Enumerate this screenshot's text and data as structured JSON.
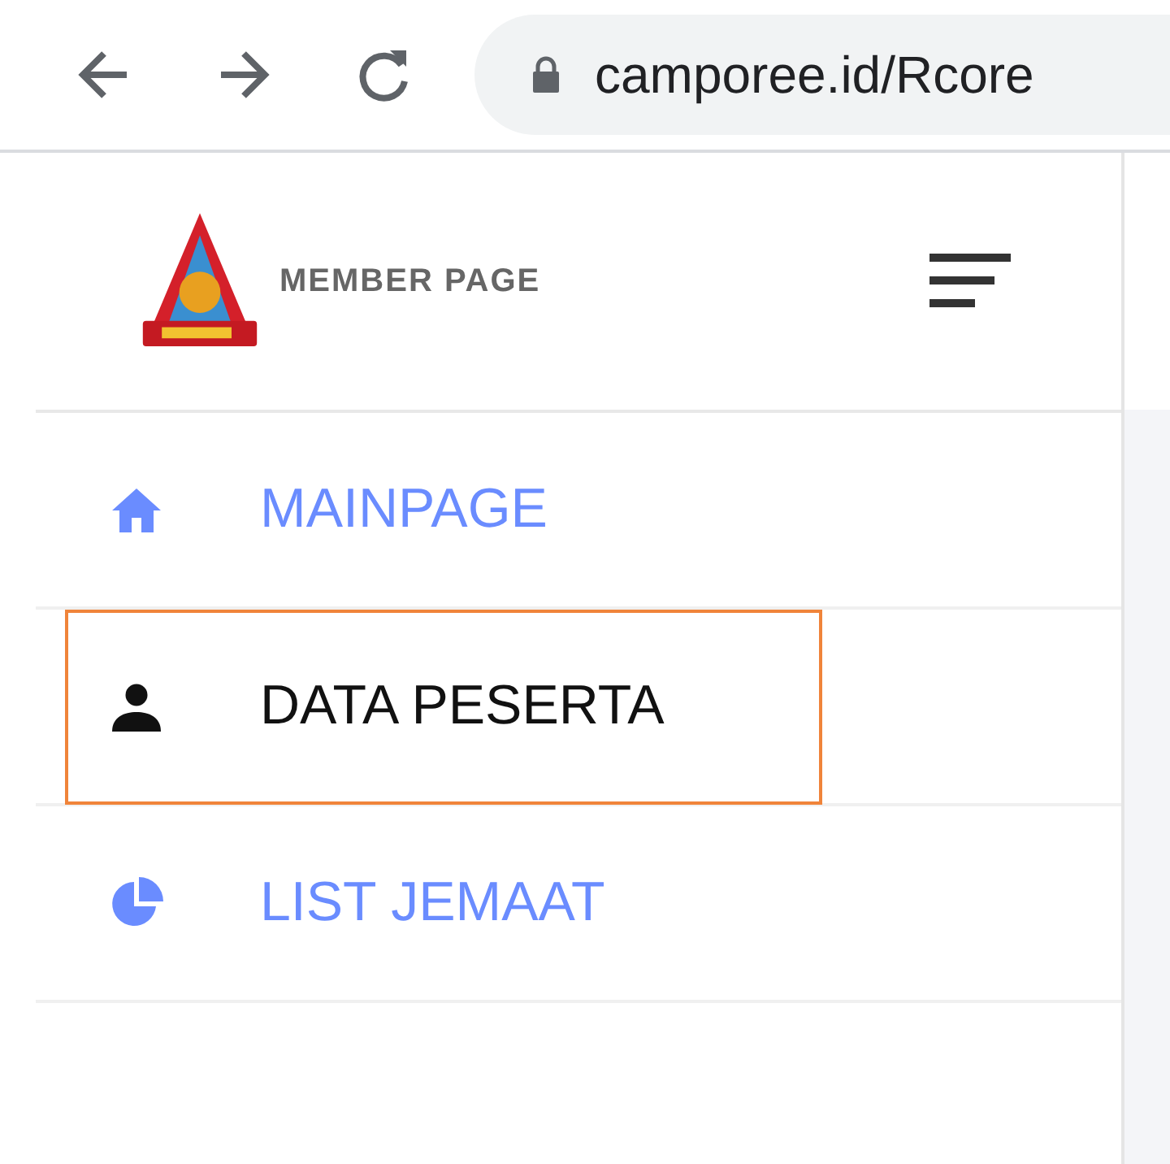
{
  "browser": {
    "url": "camporee.id/Rcore"
  },
  "sidebar": {
    "brand": "MEMBER PAGE",
    "items": [
      {
        "label": "MAINPAGE",
        "kind": "home",
        "selected": false
      },
      {
        "label": "DATA PESERTA",
        "kind": "person",
        "selected": true
      },
      {
        "label": "LIST JEMAAT",
        "kind": "chart",
        "selected": false
      }
    ]
  }
}
